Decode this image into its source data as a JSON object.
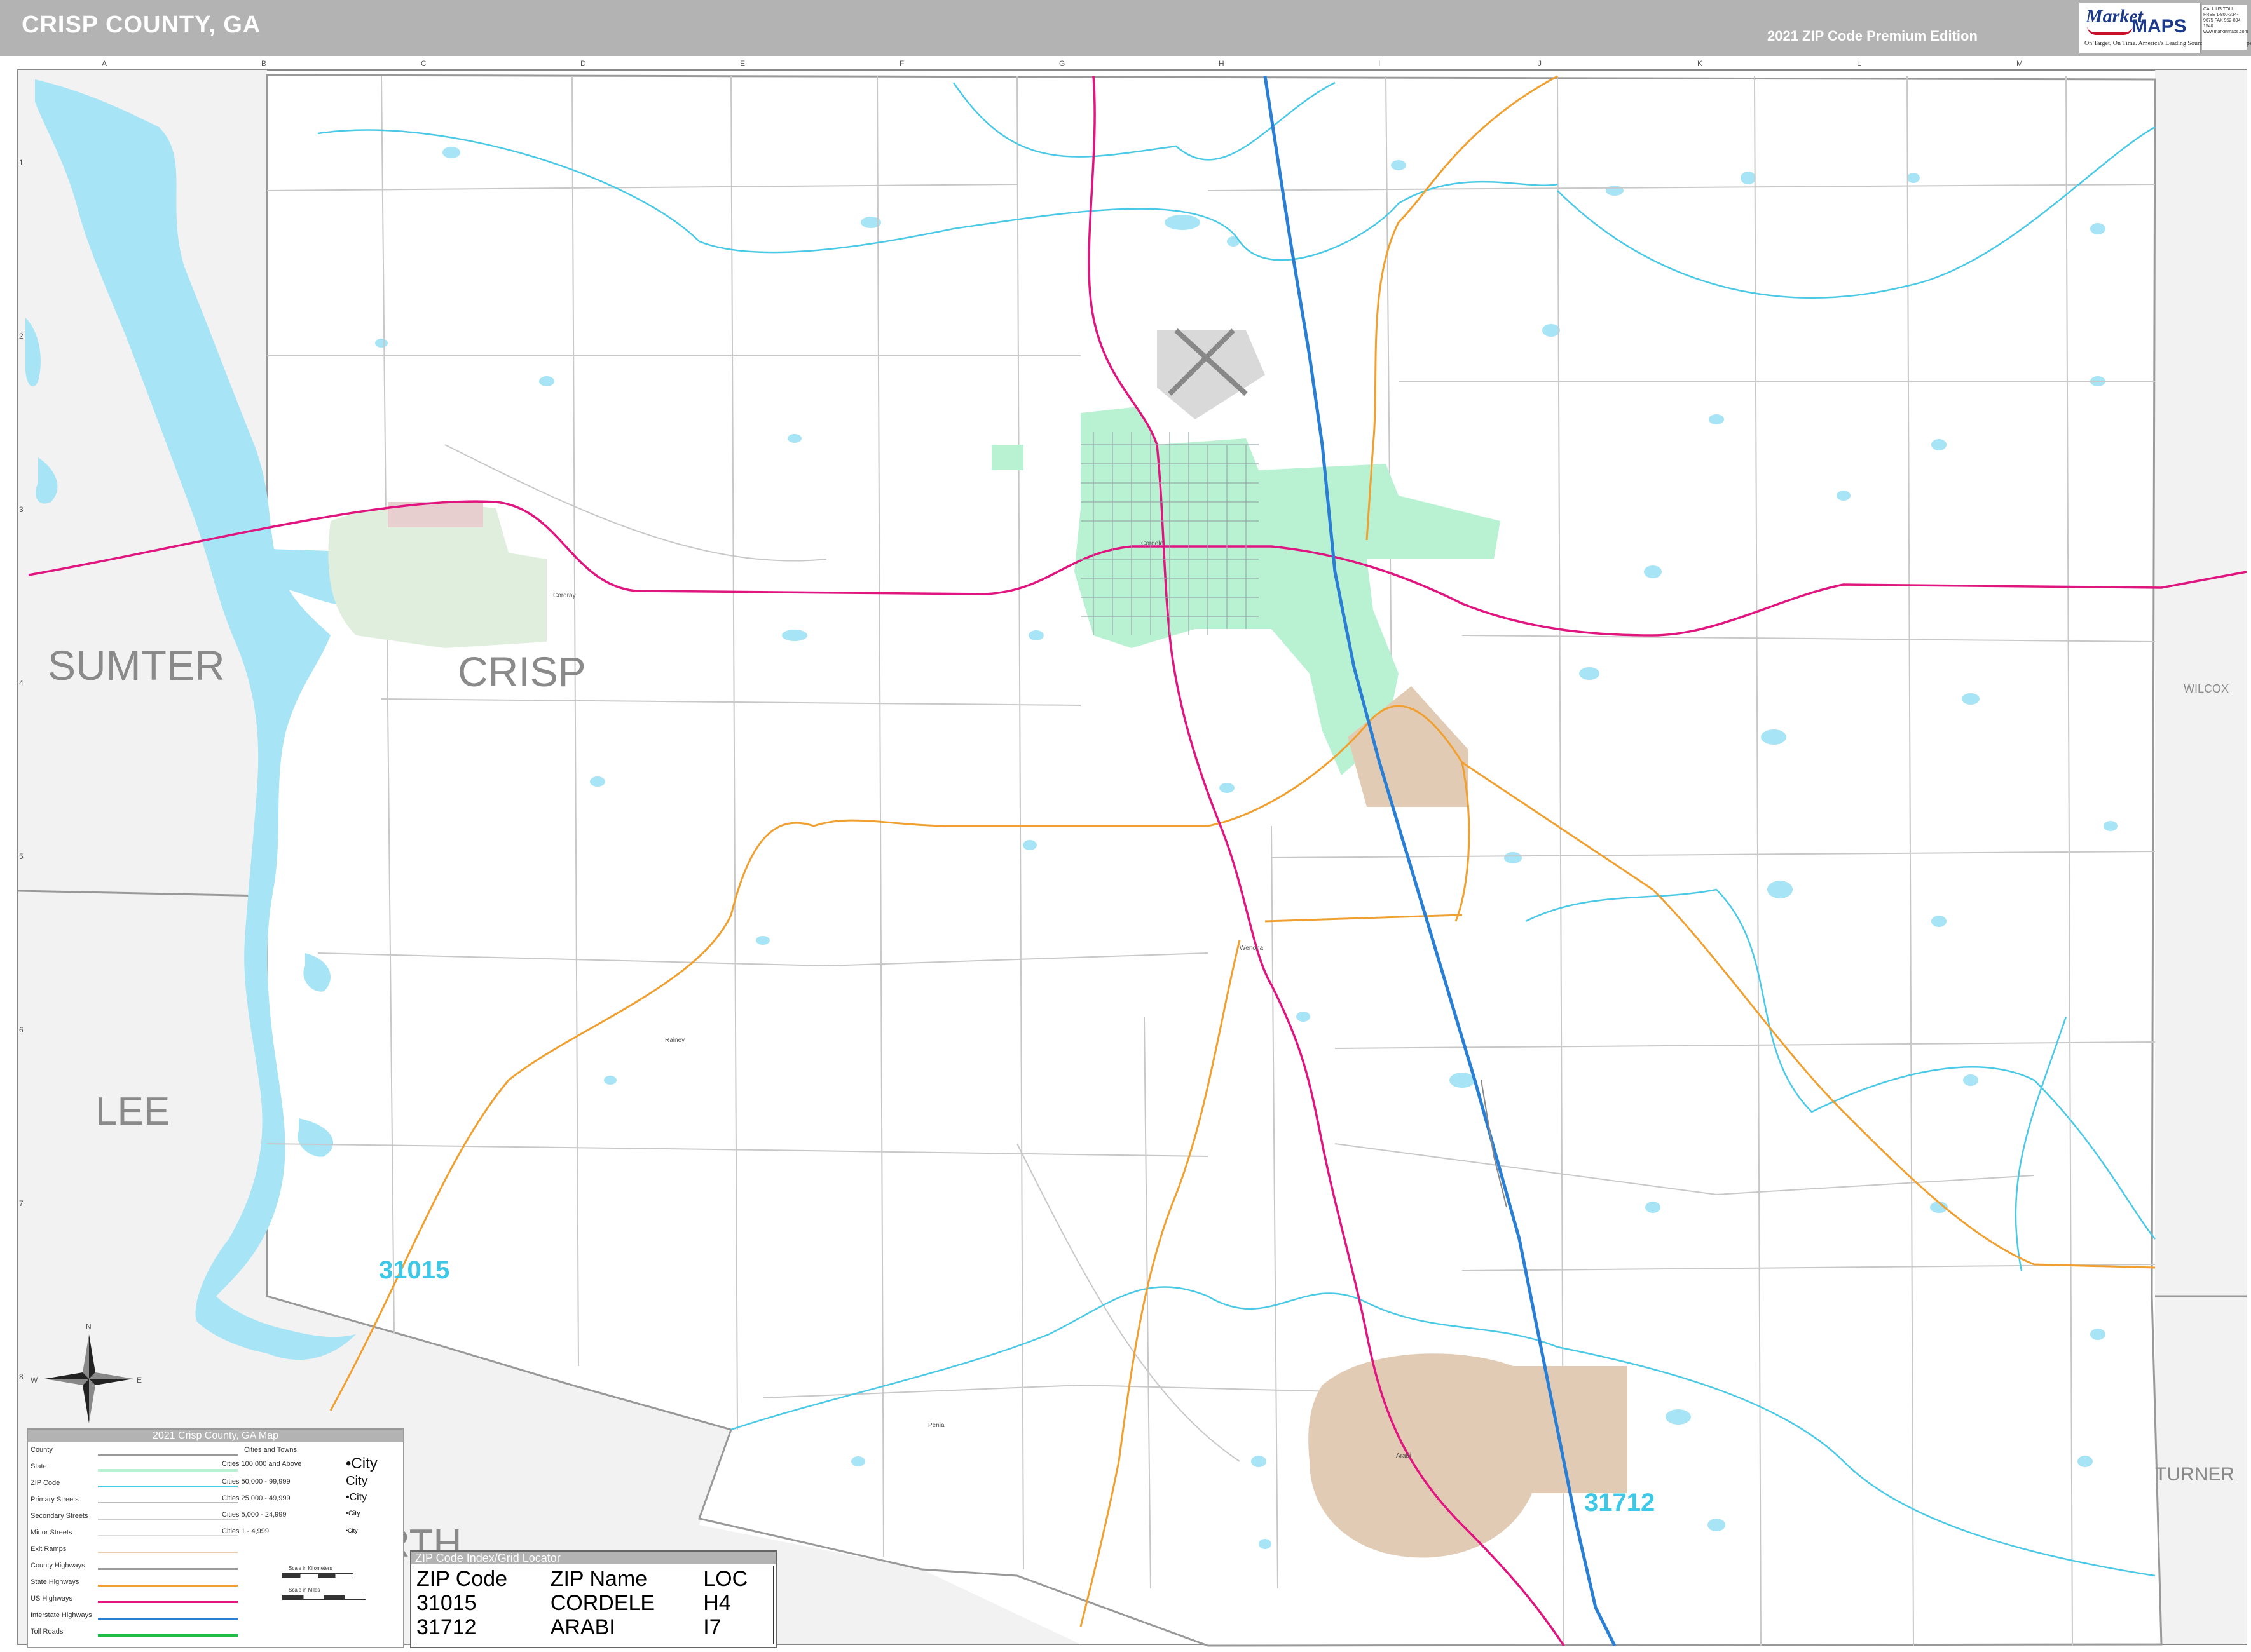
{
  "header": {
    "title": "CRISP COUNTY, GA",
    "edition": "2021 ZIP Code Premium Edition",
    "logo": {
      "brand_word1": "Market",
      "brand_word2": "MAPS",
      "tagline": "On Target, On Time. America's Leading Source of Business Maps"
    },
    "contact": "CALL US TOLL FREE 1-800-334-9675 FAX 952-894-1540 www.marketmaps.com"
  },
  "county_labels": {
    "sumter": "SUMTER",
    "crisp": "CRISP",
    "lee": "LEE",
    "wilcox": "WILCOX",
    "turner": "TURNER",
    "worth_partial": "RTH"
  },
  "zip_labels": {
    "z31015": "31015",
    "z31712": "31712"
  },
  "grid": {
    "columns": [
      "A",
      "B",
      "C",
      "D",
      "E",
      "F",
      "G",
      "H",
      "I",
      "J",
      "K",
      "L",
      "M"
    ],
    "rows": [
      "1",
      "2",
      "3",
      "4",
      "5",
      "6",
      "7",
      "8"
    ]
  },
  "places": {
    "cordele": "Cordele",
    "arabi": "Arabi",
    "wenona": "Wenona",
    "penia": "Penia",
    "cordray": "Cordray",
    "rainey": "Rainey"
  },
  "legend": {
    "title": "2021 Crisp County, GA Map",
    "rows": [
      "County",
      "State",
      "ZIP Code",
      "Primary Streets",
      "Secondary Streets",
      "Minor Streets",
      "Exit Ramps",
      "County Highways",
      "State Highways",
      "US Highways",
      "Interstate Highways",
      "Toll Roads"
    ],
    "cities_header": "Cities and Towns",
    "cities": [
      {
        "label": "Cities 100,000 and Above",
        "demo": "•City"
      },
      {
        "label": "Cities 50,000 - 99,999",
        "demo": "City"
      },
      {
        "label": "Cities 25,000 - 49,999",
        "demo": "•City"
      },
      {
        "label": "Cities 5,000 - 24,999",
        "demo": "•City"
      },
      {
        "label": "Cities 1 - 4,999",
        "demo": "•City"
      }
    ],
    "scale_km": "Scale in Kilometers",
    "scale_mi": "Scale in Miles"
  },
  "zip_index": {
    "title": "ZIP Code Index/Grid Locator",
    "headers": [
      "ZIP Code",
      "ZIP Name",
      "LOC"
    ],
    "rows": [
      [
        "31015",
        "CORDELE",
        "H4"
      ],
      [
        "31712",
        "ARABI",
        "I7"
      ]
    ]
  },
  "compass": {
    "n": "N",
    "s": "S",
    "e": "E",
    "w": "W"
  },
  "colors": {
    "water": "#a6e4f6",
    "zip_boundary": "#49c9e6",
    "us_highway": "#e0157f",
    "interstate": "#2a7fd4",
    "state_highway": "#f0a030",
    "city_green": "#b8f2d2",
    "arabi_tan": "#e2cbb4",
    "park_green": "#dfeedd"
  }
}
